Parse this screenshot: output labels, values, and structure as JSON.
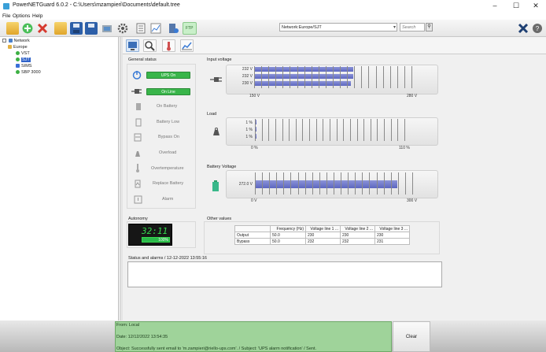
{
  "window": {
    "title": "PowerNETGuard 6.0.2 - C:\\Users\\mzampieri\\Documents\\default.tree",
    "minimize": "–",
    "maximize": "☐",
    "close": "✕"
  },
  "menu": [
    "File",
    "Options",
    "Help"
  ],
  "toolbar": {
    "icons": [
      "open-folder-icon",
      "add-icon",
      "delete-icon",
      "export-icon",
      "save-icon",
      "save-as-icon",
      "connect-icon",
      "settings-icon",
      "report-icon",
      "chart-icon",
      "device-icon",
      "ftp-icon"
    ],
    "ftp_label": "FTP",
    "network_select": "Network:Europe/SJT",
    "search_placeholder": "Search"
  },
  "tree": {
    "root": "Network",
    "group": "Europe",
    "devices": [
      {
        "label": "VST",
        "status": "#3cb043"
      },
      {
        "label": "SJT",
        "status": "#3cb043",
        "selected": true
      },
      {
        "label": "SIMS",
        "status": "#3a6fd8"
      },
      {
        "label": "SBP 3000",
        "status": "#3cb043"
      }
    ]
  },
  "general_status": {
    "title": "General status",
    "items": [
      {
        "label": "UPS On",
        "active": true,
        "icon": "power-icon"
      },
      {
        "label": "On Line",
        "active": true,
        "icon": "plug-icon"
      },
      {
        "label": "On Battery",
        "active": false,
        "icon": "battery-icon"
      },
      {
        "label": "Battery Low",
        "active": false,
        "icon": "battery-low-icon"
      },
      {
        "label": "Bypass On",
        "active": false,
        "icon": "bypass-icon"
      },
      {
        "label": "Overload",
        "active": false,
        "icon": "weight-icon"
      },
      {
        "label": "Overtemperature",
        "active": false,
        "icon": "thermometer-icon"
      },
      {
        "label": "Replace Battery",
        "active": false,
        "icon": "replace-battery-icon"
      },
      {
        "label": "Alarm",
        "active": false,
        "icon": "alarm-icon"
      }
    ]
  },
  "input_voltage": {
    "title": "Input voltage",
    "bars": [
      {
        "label": "232 V",
        "value": 232
      },
      {
        "label": "232 V",
        "value": 232
      },
      {
        "label": "230 V",
        "value": 230
      }
    ],
    "min_label": "150 V",
    "max_label": "280 V",
    "min": 150,
    "max": 280
  },
  "load": {
    "title": "Load",
    "bars": [
      {
        "label": "1 %",
        "value": 1
      },
      {
        "label": "1 %",
        "value": 1
      },
      {
        "label": "1 %",
        "value": 1
      }
    ],
    "min_label": "0 %",
    "max_label": "110 %",
    "min": 0,
    "max": 110
  },
  "battery_voltage": {
    "title": "Battery Voltage",
    "bars": [
      {
        "label": "272.0 V",
        "value": 272
      }
    ],
    "min_label": "0 V",
    "max_label": "300 V",
    "min": 0,
    "max": 300
  },
  "autonomy": {
    "title": "Autonomy",
    "time": "32:11",
    "percent": "100%",
    "charge_fraction": 1.0
  },
  "other_values": {
    "title": "Other values",
    "columns": [
      "",
      "Frequency (Hz)",
      "Voltage line 1 ...",
      "Voltage line 2 ...",
      "Voltage line 3 ..."
    ],
    "rows": [
      [
        "Output",
        "50.0",
        "230",
        "230",
        "230"
      ],
      [
        "Bypass",
        "50.0",
        "232",
        "232",
        "231"
      ]
    ]
  },
  "status_alarms": {
    "title": "Status and alarms / 12-12-2022 13:55:16"
  },
  "log": {
    "from": "From: Local",
    "date": "Date: 12/12/2022 13:54:35",
    "object": "Object: Successfully sent email to 'm.zampieri@riello-ups.com'. / Subject: 'UPS alarm notification' / Sent.",
    "clear_label": "Clear"
  },
  "colors": {
    "status_on": "#39b54a",
    "gauge_fill": "#6a73c9",
    "log_bg": "#9fd39a"
  }
}
